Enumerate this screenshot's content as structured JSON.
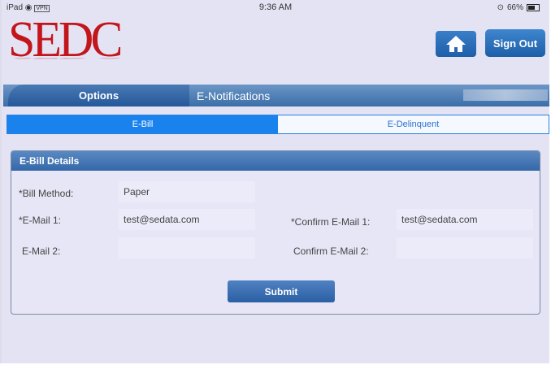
{
  "status_bar": {
    "device": "iPad",
    "vpn": "VPN",
    "time": "9:36 AM",
    "battery": "66%"
  },
  "logo": {
    "text": "SEDC"
  },
  "header": {
    "signout_label": "Sign Out",
    "home_icon": "home-icon"
  },
  "nav": {
    "options_label": "Options",
    "enotifications_label": "E-Notifications"
  },
  "tabs": [
    {
      "label": "E-Bill",
      "active": true
    },
    {
      "label": "E-Delinquent",
      "active": false
    }
  ],
  "panel": {
    "title": "E-Bill Details",
    "fields": {
      "bill_method_label": "*Bill Method:",
      "bill_method_value": "Paper",
      "email1_label": "*E-Mail 1:",
      "email1_value": "test@sedata.com",
      "confirm_email1_label": "*Confirm E-Mail 1:",
      "confirm_email1_value": "test@sedata.com",
      "email2_label": "E-Mail 2:",
      "email2_value": "",
      "confirm_email2_label": "Confirm E-Mail 2:",
      "confirm_email2_value": ""
    },
    "submit_label": "Submit"
  },
  "colors": {
    "brand_red": "#c3161c",
    "accent_blue": "#1a82ec",
    "panel_header": "#3568a8"
  }
}
